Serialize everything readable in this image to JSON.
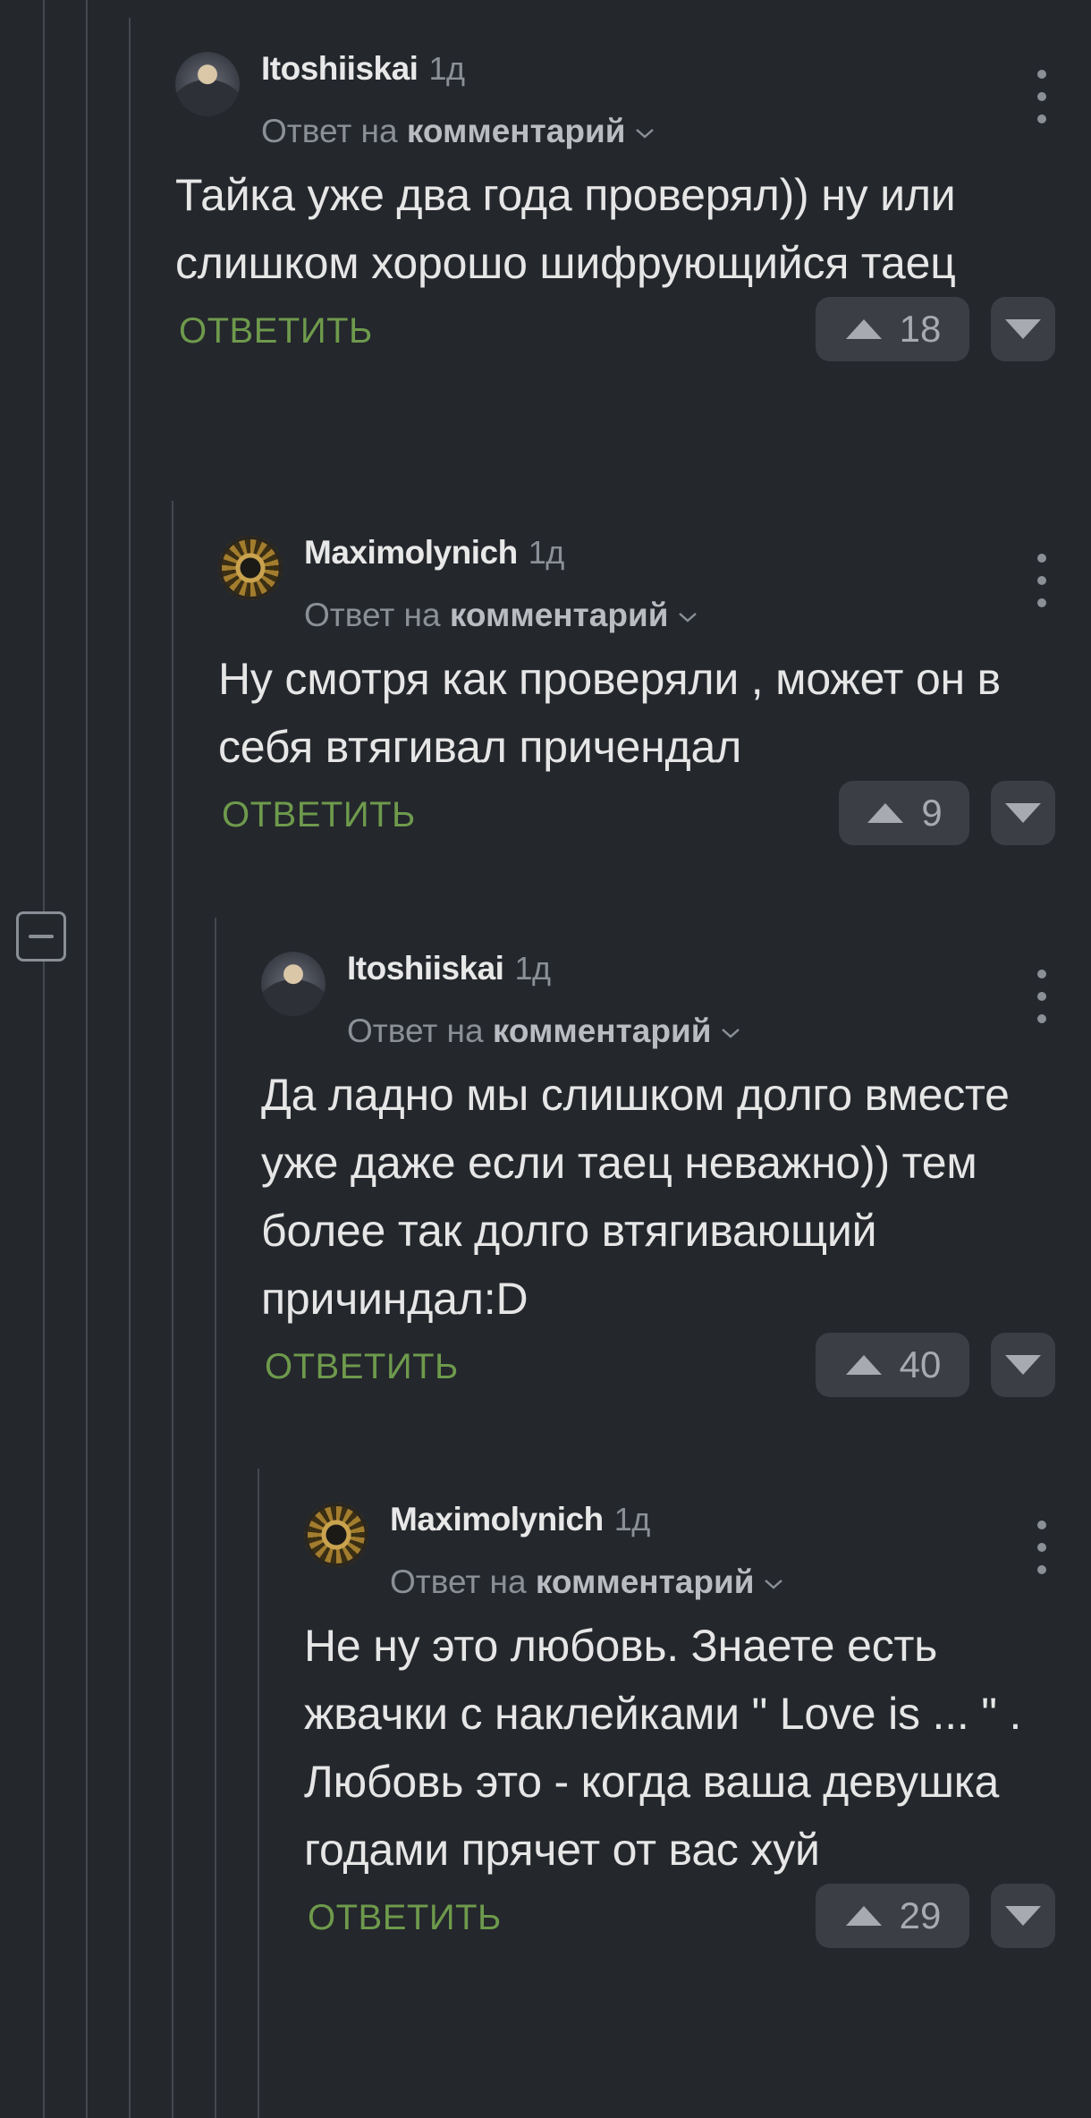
{
  "comments": [
    {
      "author": "Itoshiiskai",
      "time": "1д",
      "reply_prefix": "Ответ на",
      "reply_target": "комментарий",
      "text": "Тайка уже два года проверял)) ну или слишком хорошо шифрующийся таец",
      "reply_label": "ОТВЕТИТЬ",
      "rating": "18",
      "avatar_icon": "avatar-man-icon"
    },
    {
      "author": "Maximolynich",
      "time": "1д",
      "reply_prefix": "Ответ на",
      "reply_target": "комментарий",
      "text": "Ну смотря как проверяли , может он в себя втягивал причендал",
      "reply_label": "ОТВЕТИТЬ",
      "rating": "9",
      "avatar_icon": "avatar-emblem-icon"
    },
    {
      "author": "Itoshiiskai",
      "time": "1д",
      "reply_prefix": "Ответ на",
      "reply_target": "комментарий",
      "text": "Да ладно мы слишком долго вместе уже даже если таец неважно)) тем более так долго втягивающий причиндал:D",
      "reply_label": "ОТВЕТИТЬ",
      "rating": "40",
      "avatar_icon": "avatar-man-icon"
    },
    {
      "author": "Maximolynich",
      "time": "1д",
      "reply_prefix": "Ответ на",
      "reply_target": "комментарий",
      "text": "Не ну это любовь. Знаете есть жвачки с наклейками \" Love is ... \" . Любовь это - когда ваша девушка годами прячет от вас хуй",
      "reply_label": "ОТВЕТИТЬ",
      "rating": "29",
      "avatar_icon": "avatar-emblem-icon"
    }
  ],
  "colors": {
    "background": "#24272c",
    "reply_green": "#6e9a4c",
    "thread_line": "#44484f",
    "vote_bg": "#3b3e44"
  },
  "icons": {
    "collapse": "minus-square-icon",
    "menu": "kebab-menu-icon",
    "upvote": "triangle-up-icon",
    "downvote": "triangle-down-icon",
    "expand": "chevron-down-icon"
  }
}
